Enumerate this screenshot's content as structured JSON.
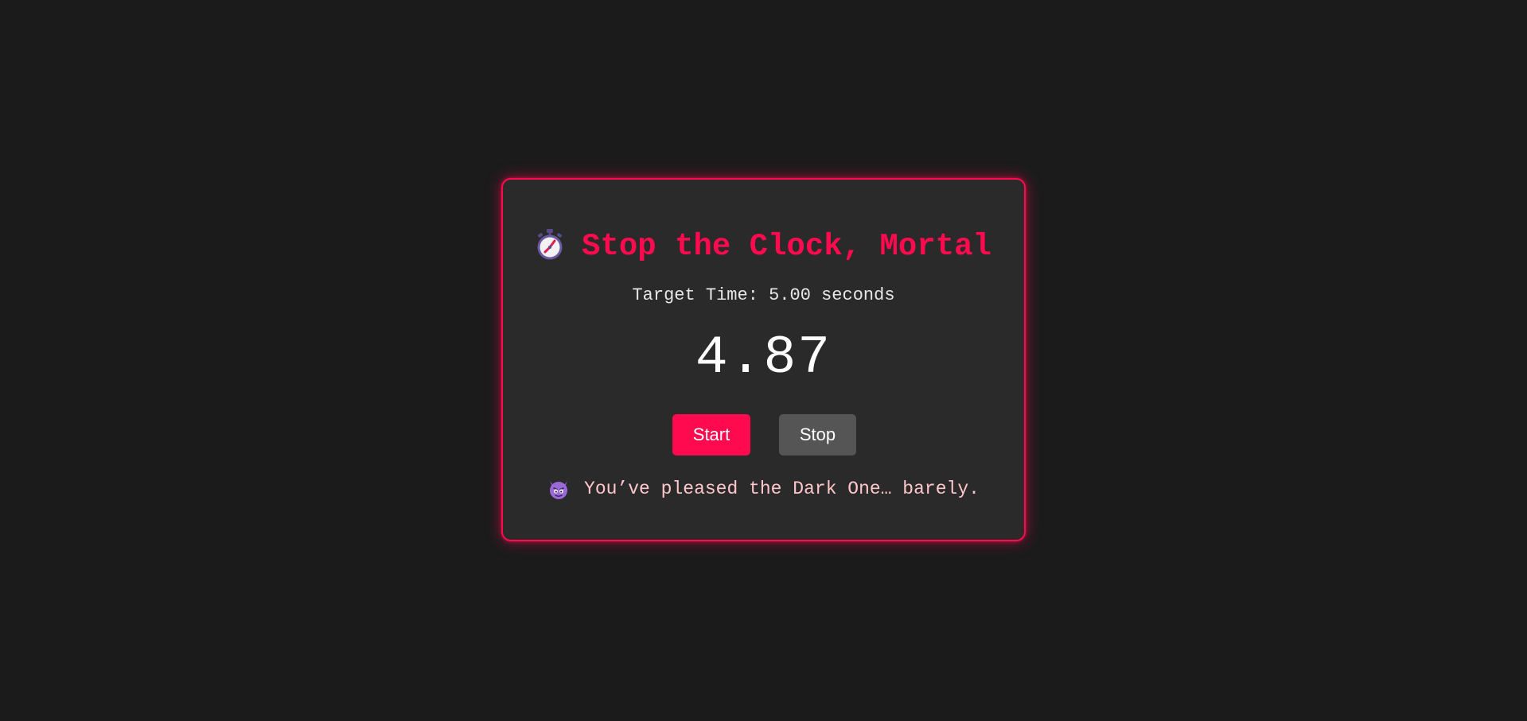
{
  "game": {
    "title": "Stop the Clock, Mortal",
    "title_icon": "stopwatch-icon",
    "target_label": "Target Time: 5.00 seconds",
    "timer_value": "4.87",
    "start_label": "Start",
    "stop_label": "Stop",
    "result_icon": "smiling-devil-icon",
    "result_message": "You’ve pleased the Dark One… barely."
  },
  "colors": {
    "background": "#1b1b1b",
    "card": "#2a2a2a",
    "accent": "#ff0a4f",
    "stop_button": "#555555",
    "message": "#ffc7cc"
  }
}
